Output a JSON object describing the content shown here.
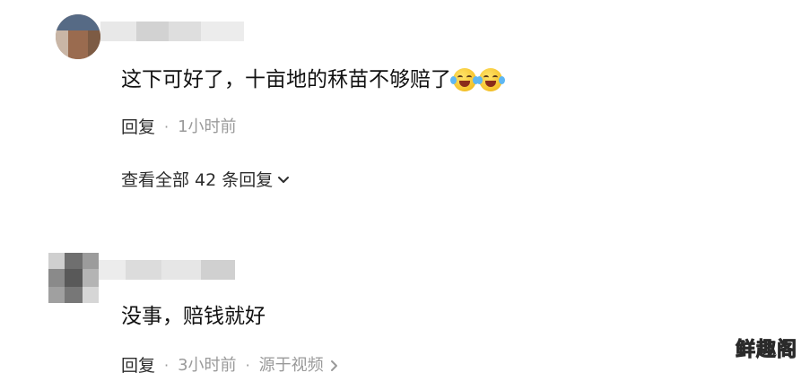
{
  "comments": [
    {
      "text": "这下可好了，十亩地的秝苗不够赔了",
      "emojis": [
        "crying-laughing-face-icon",
        "crying-laughing-face-icon"
      ],
      "reply_label": "回复",
      "separator": "·",
      "time": "1小时前",
      "view_replies_label": "查看全部 42 条回复"
    },
    {
      "text": "没事，赔钱就好",
      "reply_label": "回复",
      "separator": "·",
      "time": "3小时前",
      "separator2": "·",
      "source_label": "源于视频"
    }
  ],
  "watermark": "鲜趣阁",
  "colors": {
    "text_primary": "#111111",
    "text_secondary": "#9a9a9a",
    "background": "#ffffff"
  }
}
